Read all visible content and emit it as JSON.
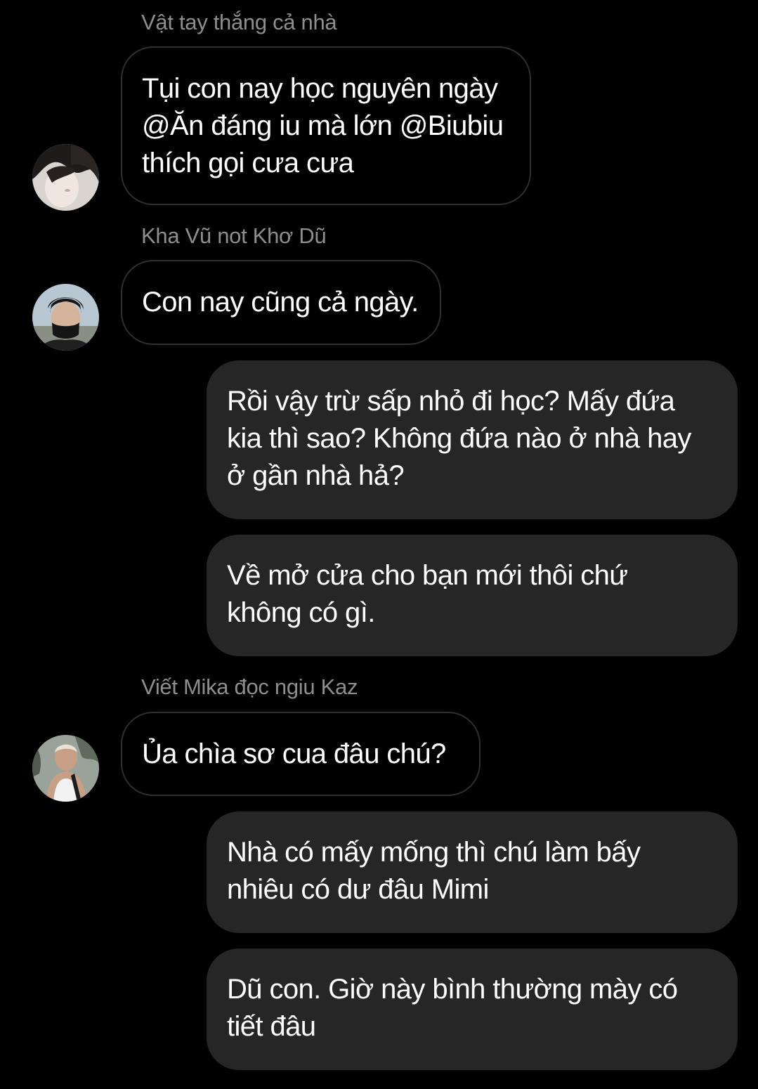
{
  "messages": [
    {
      "sender": "Vật tay thắng cả nhà",
      "avatar_icon": "user-avatar-1-icon",
      "text": "Tụi con nay học nguyên ngày\n@Ăn đáng iu mà lớn @Biubiu\nthích gọi cưa cưa"
    },
    {
      "sender": "Kha Vũ not Khơ Dũ",
      "avatar_icon": "user-avatar-2-icon",
      "text": "Con nay cũng cả ngày."
    },
    {
      "sender": "",
      "text": "Rồi vậy trừ sấp nhỏ đi học?  Mấy đứa\nkia thì sao? Không đứa nào ở nhà hay\nở gần nhà hả?"
    },
    {
      "sender": "",
      "text": "Về mở cửa cho bạn mới thôi chứ\nkhông có gì."
    },
    {
      "sender": "Viết Mika đọc ngiu Kaz",
      "avatar_icon": "user-avatar-3-icon",
      "text": "Ủa chìa sơ cua đâu chú?"
    },
    {
      "sender": "",
      "text": "Nhà có mấy mống thì chú làm bấy\nnhiêu có dư đâu Mimi"
    },
    {
      "sender": "",
      "text": "Dũ con. Giờ này bình thường mày có\ntiết đâu"
    }
  ],
  "colors": {
    "background": "#000000",
    "incoming_border": "#2f2f2f",
    "outgoing_bubble": "#262626",
    "sender_name": "#8e8e8e",
    "text": "#ffffff"
  }
}
